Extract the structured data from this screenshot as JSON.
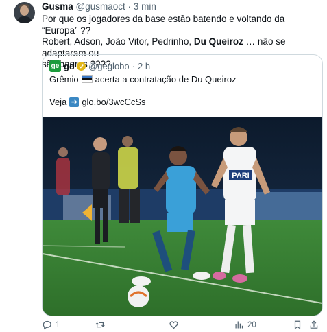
{
  "tweet": {
    "author_name": "Gusma",
    "author_handle": "@gusmaoct",
    "separator": "·",
    "time": "3 min",
    "text_part1": "Por que os jogadores da base estão batendo e voltando da “Europa” ??",
    "text_part2": "Robert, Adson, João Vitor, Pedrinho, ",
    "text_bold": "Du Queiroz",
    "text_part3": " … não se adaptaram ou",
    "text_part4": "são bagres ????"
  },
  "quote": {
    "logo_text": "ge",
    "name": "ge",
    "handle": "@geglobo",
    "separator": "·",
    "time": "2 h",
    "line1_before": "Grêmio",
    "line1_after": "acerta a contratação de Du Queiroz",
    "line2_before": "Veja",
    "link": "glo.bo/3wcCcSs",
    "photo_jersey_text": "PARI"
  },
  "actions": {
    "reply_count": "1",
    "retweet_count": "",
    "like_count": "",
    "views_count": "20"
  },
  "colors": {
    "accent": "#1d9bf0",
    "muted": "#536471",
    "border": "#cfd9de",
    "ge_green": "#1c9b3c"
  },
  "icons": [
    "reply-icon",
    "retweet-icon",
    "like-icon",
    "views-icon",
    "bookmark-icon",
    "share-icon",
    "verified-icon",
    "flag-icon",
    "arrow-icon"
  ]
}
